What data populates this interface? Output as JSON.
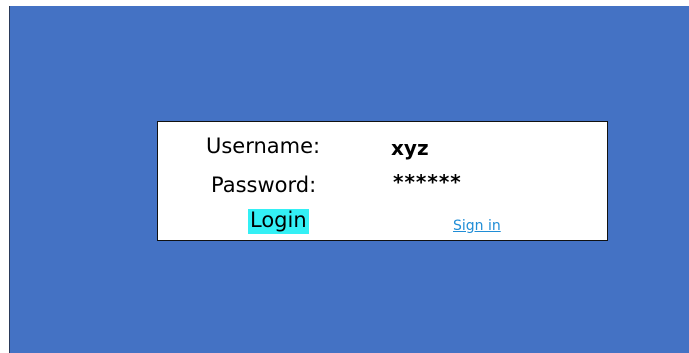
{
  "colors": {
    "background": "#4472C4",
    "panel": "#FFFFFF",
    "login_button": "#33F0F5",
    "link": "#1F8DD6"
  },
  "form": {
    "username_label": "Username:",
    "username_value": "xyz",
    "password_label": "Password:",
    "password_value": "******",
    "login_label": "Login",
    "signin_label": "Sign in"
  }
}
